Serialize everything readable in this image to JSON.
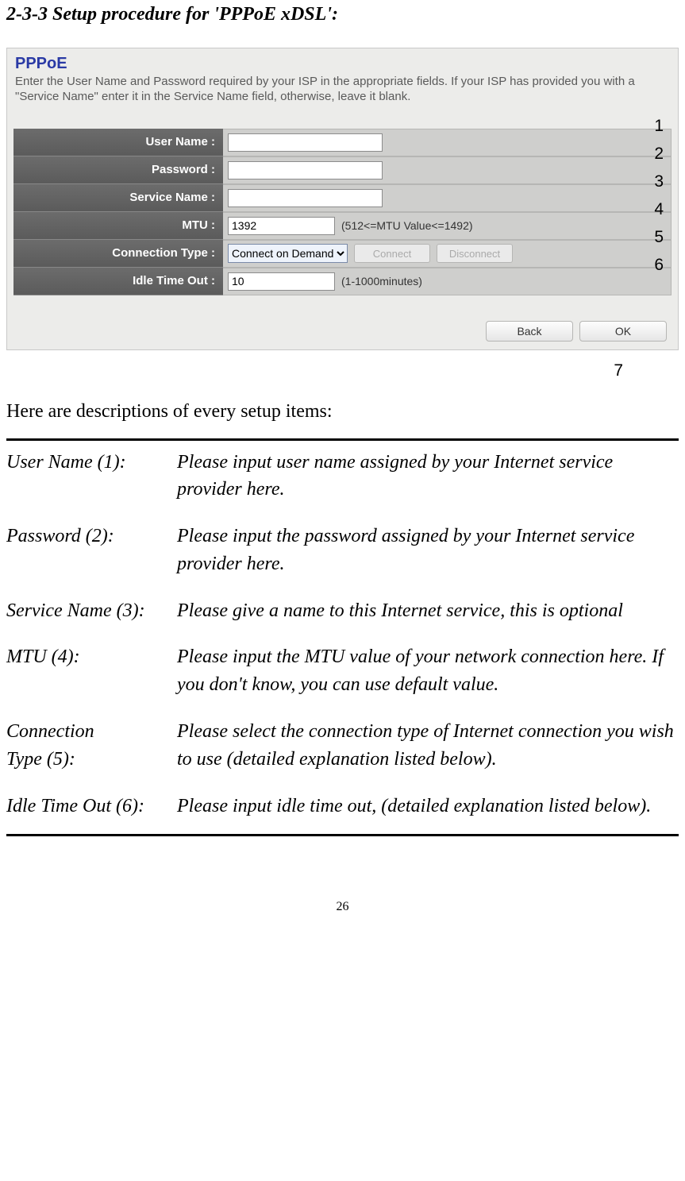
{
  "section_title": "2-3-3 Setup procedure for 'PPPoE xDSL':",
  "panel": {
    "title": "PPPoE",
    "description": "Enter the User Name and Password required by your ISP in the appropriate fields. If your ISP has provided you with a \"Service Name\" enter it in the Service Name field, otherwise, leave it blank."
  },
  "form": {
    "rows": [
      {
        "label": "User Name :",
        "value": "",
        "type": "text",
        "annot": "1"
      },
      {
        "label": "Password :",
        "value": "",
        "type": "password",
        "annot": "2"
      },
      {
        "label": "Service Name :",
        "value": "",
        "type": "text",
        "annot": "3"
      },
      {
        "label": "MTU :",
        "value": "1392",
        "hint": "(512<=MTU Value<=1492)",
        "type": "text-short",
        "annot": "4"
      },
      {
        "label": "Connection Type :",
        "value": "Connect on Demand",
        "type": "select",
        "buttons": [
          "Connect",
          "Disconnect"
        ],
        "annot": "5"
      },
      {
        "label": "Idle Time Out :",
        "value": "10",
        "hint": "(1-1000minutes)",
        "type": "text-short",
        "annot": "6"
      }
    ],
    "bottom_buttons": {
      "back": "Back",
      "ok": "OK",
      "annot": "7"
    }
  },
  "intro": "Here are descriptions of every setup items:",
  "descriptions": [
    {
      "label": "User Name (1):",
      "text": "Please input user name assigned by your Internet service provider here."
    },
    {
      "label": "Password (2):",
      "text": "Please input the password assigned by your Internet service provider here."
    },
    {
      "label": "Service Name (3):",
      "text": "Please give a name to this Internet service, this is optional"
    },
    {
      "label": "MTU (4):",
      "text": "Please input the MTU value of your network connection here. If you don't know, you can use default value."
    },
    {
      "label_a": "Connection",
      "label_b": "Type (5):",
      "text": "Please select the connection type of Internet connection you wish to use (detailed explanation listed below)."
    },
    {
      "label": "Idle Time Out (6):",
      "text": "Please input idle time out, (detailed explanation listed below)."
    }
  ],
  "page_number": "26"
}
